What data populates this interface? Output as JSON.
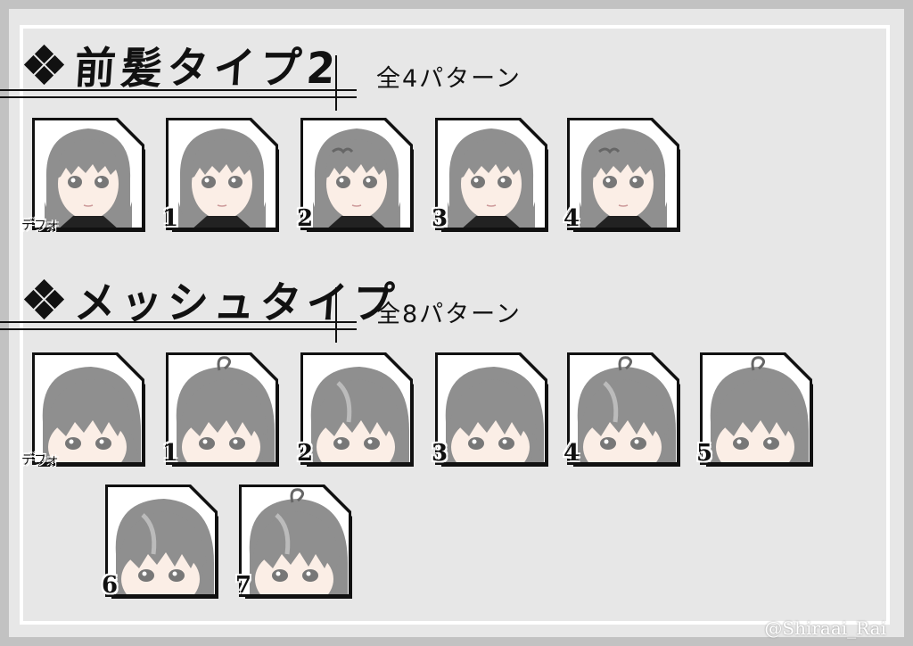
{
  "sections": [
    {
      "title": "前髪タイプ2",
      "count": "全4パターン",
      "cards": [
        "デフォ",
        "1",
        "2",
        "3",
        "4"
      ],
      "style": "bangs"
    },
    {
      "title": "メッシュタイプ",
      "count": "全8パターン",
      "cards": [
        "デフォ",
        "1",
        "2",
        "3",
        "4",
        "5",
        "6",
        "7"
      ],
      "style": "mesh"
    }
  ],
  "watermark": "@Shiraai_Rai",
  "colors": {
    "background": "#c2c2c2",
    "panel": "#e7e7e7",
    "hair": "#8f8f8f",
    "skin": "#fbeee6"
  }
}
